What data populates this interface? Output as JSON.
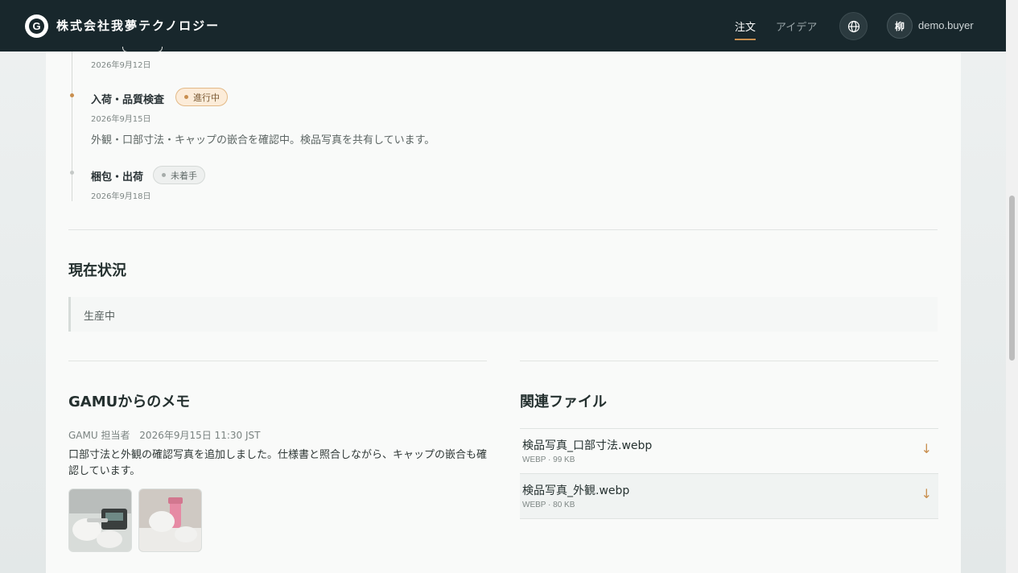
{
  "header": {
    "brand": "株式会社我夢テクノロジー",
    "logo_letter": "G",
    "nav": [
      {
        "label": "注文",
        "active": true
      },
      {
        "label": "アイデア",
        "active": false
      }
    ],
    "globe_icon": "globe-icon",
    "avatar_initial": "柳",
    "user_name": "demo.buyer"
  },
  "timeline": {
    "prev_date": "2026年9月12日",
    "steps": [
      {
        "title": "入荷・品質検査",
        "status": "進行中",
        "date": "2026年9月15日",
        "description": "外観・口部寸法・キャップの嵌合を確認中。検品写真を共有しています。"
      },
      {
        "title": "梱包・出荷",
        "status": "未着手",
        "date": "2026年9月18日"
      }
    ]
  },
  "current_status": {
    "title": "現在状況",
    "value": "生産中"
  },
  "memo": {
    "title": "GAMUからのメモ",
    "author": "GAMU 担当者",
    "timestamp": "2026年9月15日 11:30 JST",
    "body": "口部寸法と外観の確認写真を追加しました。仕様書と照合しながら、キャップの嵌合も確認しています。"
  },
  "files": {
    "title": "関連ファイル",
    "items": [
      {
        "name": "検品写真_口部寸法.webp",
        "meta": "WEBP · 99 KB"
      },
      {
        "name": "検品写真_外観.webp",
        "meta": "WEBP · 80 KB"
      }
    ]
  },
  "colors": {
    "header_bg": "#18272c",
    "accent": "#c98f4f"
  }
}
